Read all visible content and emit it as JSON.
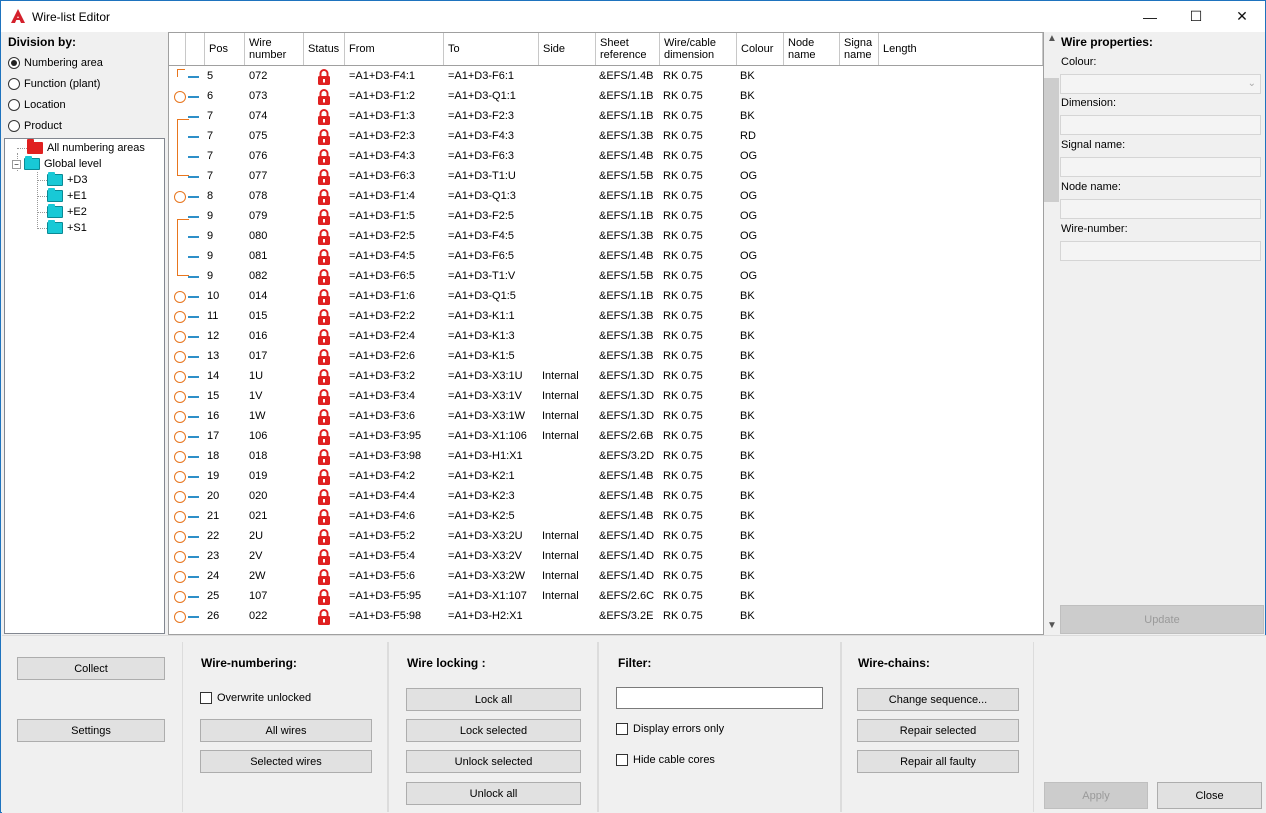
{
  "window": {
    "title": "Wire-list Editor",
    "minimize": "—",
    "maximize": "☐",
    "close": "✕"
  },
  "division": {
    "title": "Division by:",
    "options": [
      {
        "label": "Numbering area",
        "selected": true
      },
      {
        "label": "Function (plant)",
        "selected": false
      },
      {
        "label": "Location",
        "selected": false
      },
      {
        "label": "Product",
        "selected": false
      }
    ],
    "tree": {
      "root": "All numbering areas",
      "global": "Global level",
      "children": [
        "+D3",
        "+E1",
        "+E2",
        "+S1"
      ]
    }
  },
  "grid": {
    "columns": [
      "",
      "",
      "Pos",
      "Wire\nnumber",
      "Status",
      "From",
      "To",
      "Side",
      "Sheet\nreference",
      "Wire/cable\ndimension",
      "Colour",
      "Node\nname",
      "Signa\nname",
      "Length"
    ],
    "rows": [
      {
        "marker": "none",
        "pos": "5",
        "wire": "072",
        "from": "=A1+D3-F4:1",
        "to": "=A1+D3-F6:1",
        "side": "",
        "sheet": "&EFS/1.4B",
        "dim": "RK 0.75",
        "colour": "BK"
      },
      {
        "marker": "circle",
        "pos": "6",
        "wire": "073",
        "from": "=A1+D3-F1:2",
        "to": "=A1+D3-Q1:1",
        "side": "",
        "sheet": "&EFS/1.1B",
        "dim": "RK 0.75",
        "colour": "BK"
      },
      {
        "marker": "none",
        "pos": "7",
        "wire": "074",
        "from": "=A1+D3-F1:3",
        "to": "=A1+D3-F2:3",
        "side": "",
        "sheet": "&EFS/1.1B",
        "dim": "RK 0.75",
        "colour": "BK"
      },
      {
        "marker": "none",
        "pos": "7",
        "wire": "075",
        "from": "=A1+D3-F2:3",
        "to": "=A1+D3-F4:3",
        "side": "",
        "sheet": "&EFS/1.3B",
        "dim": "RK 0.75",
        "colour": "RD"
      },
      {
        "marker": "none",
        "pos": "7",
        "wire": "076",
        "from": "=A1+D3-F4:3",
        "to": "=A1+D3-F6:3",
        "side": "",
        "sheet": "&EFS/1.4B",
        "dim": "RK 0.75",
        "colour": "OG"
      },
      {
        "marker": "none",
        "pos": "7",
        "wire": "077",
        "from": "=A1+D3-F6:3",
        "to": "=A1+D3-T1:U",
        "side": "",
        "sheet": "&EFS/1.5B",
        "dim": "RK 0.75",
        "colour": "OG"
      },
      {
        "marker": "circle",
        "pos": "8",
        "wire": "078",
        "from": "=A1+D3-F1:4",
        "to": "=A1+D3-Q1:3",
        "side": "",
        "sheet": "&EFS/1.1B",
        "dim": "RK 0.75",
        "colour": "OG"
      },
      {
        "marker": "none",
        "pos": "9",
        "wire": "079",
        "from": "=A1+D3-F1:5",
        "to": "=A1+D3-F2:5",
        "side": "",
        "sheet": "&EFS/1.1B",
        "dim": "RK 0.75",
        "colour": "OG"
      },
      {
        "marker": "none",
        "pos": "9",
        "wire": "080",
        "from": "=A1+D3-F2:5",
        "to": "=A1+D3-F4:5",
        "side": "",
        "sheet": "&EFS/1.3B",
        "dim": "RK 0.75",
        "colour": "OG"
      },
      {
        "marker": "none",
        "pos": "9",
        "wire": "081",
        "from": "=A1+D3-F4:5",
        "to": "=A1+D3-F6:5",
        "side": "",
        "sheet": "&EFS/1.4B",
        "dim": "RK 0.75",
        "colour": "OG"
      },
      {
        "marker": "none",
        "pos": "9",
        "wire": "082",
        "from": "=A1+D3-F6:5",
        "to": "=A1+D3-T1:V",
        "side": "",
        "sheet": "&EFS/1.5B",
        "dim": "RK 0.75",
        "colour": "OG"
      },
      {
        "marker": "circle",
        "pos": "10",
        "wire": "014",
        "from": "=A1+D3-F1:6",
        "to": "=A1+D3-Q1:5",
        "side": "",
        "sheet": "&EFS/1.1B",
        "dim": "RK 0.75",
        "colour": "BK"
      },
      {
        "marker": "circle",
        "pos": "11",
        "wire": "015",
        "from": "=A1+D3-F2:2",
        "to": "=A1+D3-K1:1",
        "side": "",
        "sheet": "&EFS/1.3B",
        "dim": "RK 0.75",
        "colour": "BK"
      },
      {
        "marker": "circle",
        "pos": "12",
        "wire": "016",
        "from": "=A1+D3-F2:4",
        "to": "=A1+D3-K1:3",
        "side": "",
        "sheet": "&EFS/1.3B",
        "dim": "RK 0.75",
        "colour": "BK"
      },
      {
        "marker": "circle",
        "pos": "13",
        "wire": "017",
        "from": "=A1+D3-F2:6",
        "to": "=A1+D3-K1:5",
        "side": "",
        "sheet": "&EFS/1.3B",
        "dim": "RK 0.75",
        "colour": "BK"
      },
      {
        "marker": "circle",
        "pos": "14",
        "wire": "1U",
        "from": "=A1+D3-F3:2",
        "to": "=A1+D3-X3:1U",
        "side": "Internal",
        "sheet": "&EFS/1.3D",
        "dim": "RK 0.75",
        "colour": "BK"
      },
      {
        "marker": "circle",
        "pos": "15",
        "wire": "1V",
        "from": "=A1+D3-F3:4",
        "to": "=A1+D3-X3:1V",
        "side": "Internal",
        "sheet": "&EFS/1.3D",
        "dim": "RK 0.75",
        "colour": "BK"
      },
      {
        "marker": "circle",
        "pos": "16",
        "wire": "1W",
        "from": "=A1+D3-F3:6",
        "to": "=A1+D3-X3:1W",
        "side": "Internal",
        "sheet": "&EFS/1.3D",
        "dim": "RK 0.75",
        "colour": "BK"
      },
      {
        "marker": "circle",
        "pos": "17",
        "wire": "106",
        "from": "=A1+D3-F3:95",
        "to": "=A1+D3-X1:106",
        "side": "Internal",
        "sheet": "&EFS/2.6B",
        "dim": "RK 0.75",
        "colour": "BK"
      },
      {
        "marker": "circle",
        "pos": "18",
        "wire": "018",
        "from": "=A1+D3-F3:98",
        "to": "=A1+D3-H1:X1",
        "side": "",
        "sheet": "&EFS/3.2D",
        "dim": "RK 0.75",
        "colour": "BK"
      },
      {
        "marker": "circle",
        "pos": "19",
        "wire": "019",
        "from": "=A1+D3-F4:2",
        "to": "=A1+D3-K2:1",
        "side": "",
        "sheet": "&EFS/1.4B",
        "dim": "RK 0.75",
        "colour": "BK"
      },
      {
        "marker": "circle",
        "pos": "20",
        "wire": "020",
        "from": "=A1+D3-F4:4",
        "to": "=A1+D3-K2:3",
        "side": "",
        "sheet": "&EFS/1.4B",
        "dim": "RK 0.75",
        "colour": "BK"
      },
      {
        "marker": "circle",
        "pos": "21",
        "wire": "021",
        "from": "=A1+D3-F4:6",
        "to": "=A1+D3-K2:5",
        "side": "",
        "sheet": "&EFS/1.4B",
        "dim": "RK 0.75",
        "colour": "BK"
      },
      {
        "marker": "circle",
        "pos": "22",
        "wire": "2U",
        "from": "=A1+D3-F5:2",
        "to": "=A1+D3-X3:2U",
        "side": "Internal",
        "sheet": "&EFS/1.4D",
        "dim": "RK 0.75",
        "colour": "BK"
      },
      {
        "marker": "circle",
        "pos": "23",
        "wire": "2V",
        "from": "=A1+D3-F5:4",
        "to": "=A1+D3-X3:2V",
        "side": "Internal",
        "sheet": "&EFS/1.4D",
        "dim": "RK 0.75",
        "colour": "BK"
      },
      {
        "marker": "circle",
        "pos": "24",
        "wire": "2W",
        "from": "=A1+D3-F5:6",
        "to": "=A1+D3-X3:2W",
        "side": "Internal",
        "sheet": "&EFS/1.4D",
        "dim": "RK 0.75",
        "colour": "BK"
      },
      {
        "marker": "circle",
        "pos": "25",
        "wire": "107",
        "from": "=A1+D3-F5:95",
        "to": "=A1+D3-X1:107",
        "side": "Internal",
        "sheet": "&EFS/2.6C",
        "dim": "RK 0.75",
        "colour": "BK"
      },
      {
        "marker": "circle",
        "pos": "26",
        "wire": "022",
        "from": "=A1+D3-F5:98",
        "to": "=A1+D3-H2:X1",
        "side": "",
        "sheet": "&EFS/3.2E",
        "dim": "RK 0.75",
        "colour": "BK"
      }
    ]
  },
  "properties": {
    "title": "Wire properties:",
    "labels": [
      "Colour:",
      "Dimension:",
      "Signal name:",
      "Node name:",
      "Wire-number:"
    ],
    "update": "Update"
  },
  "bottom": {
    "collect": "Collect",
    "settings": "Settings",
    "numbering": {
      "title": "Wire-numbering:",
      "overwrite": "Overwrite unlocked",
      "all": "All wires",
      "selected": "Selected wires"
    },
    "locking": {
      "title": "Wire locking :",
      "lock_all": "Lock all",
      "lock_sel": "Lock selected",
      "unlock_sel": "Unlock selected",
      "unlock_all": "Unlock all"
    },
    "filter": {
      "title": "Filter:",
      "value": "",
      "errors": "Display errors only",
      "hide": "Hide cable cores"
    },
    "chains": {
      "title": "Wire-chains:",
      "change": "Change sequence...",
      "repair_sel": "Repair selected",
      "repair_all": "Repair all faulty"
    },
    "apply": "Apply",
    "close": "Close"
  },
  "colors": {
    "accent": "#1e73be",
    "marker": "#e8761e",
    "dash": "#2e8fc8",
    "lock": "#e02020"
  }
}
